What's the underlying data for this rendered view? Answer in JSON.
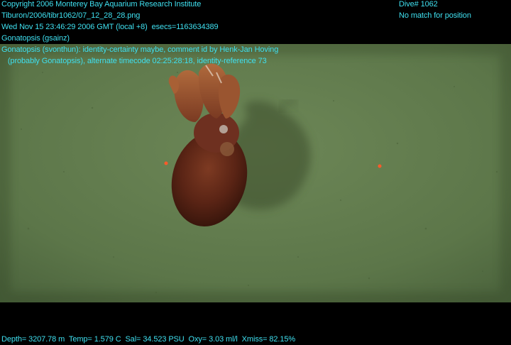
{
  "overlay": {
    "copyright": "Copyright 2006 Monterey Bay Aquarium Research Institute",
    "file_path": "Tiburon/2006/tibr1062/07_12_28_28.png",
    "timestamp": "Wed Nov 15 23:46:29 2006 GMT (local +8)  esecs=1163634389",
    "taxon": "Gonatopsis (gsainz)",
    "annotation_line1": "Gonatopsis (svonthun): identity-certainty maybe, comment id by Henk-Jan Hoving",
    "annotation_line2": "   (probably Gonatopsis), alternate timecode 02:25:28:18, identity-reference 73",
    "dive": "Dive# 1062",
    "position_status": "No match for position",
    "telemetry": "Depth= 3207.78 m  Temp= 1.579 C  Sal= 34.523 PSU  Oxy= 3.03 ml/l  Xmiss= 82.15%"
  },
  "colors": {
    "overlay_text": "#3fe0f0",
    "seafloor": "#5f7a4c",
    "laser_dot": "#ff5a2a",
    "squid_body": "#6a2d1c"
  }
}
